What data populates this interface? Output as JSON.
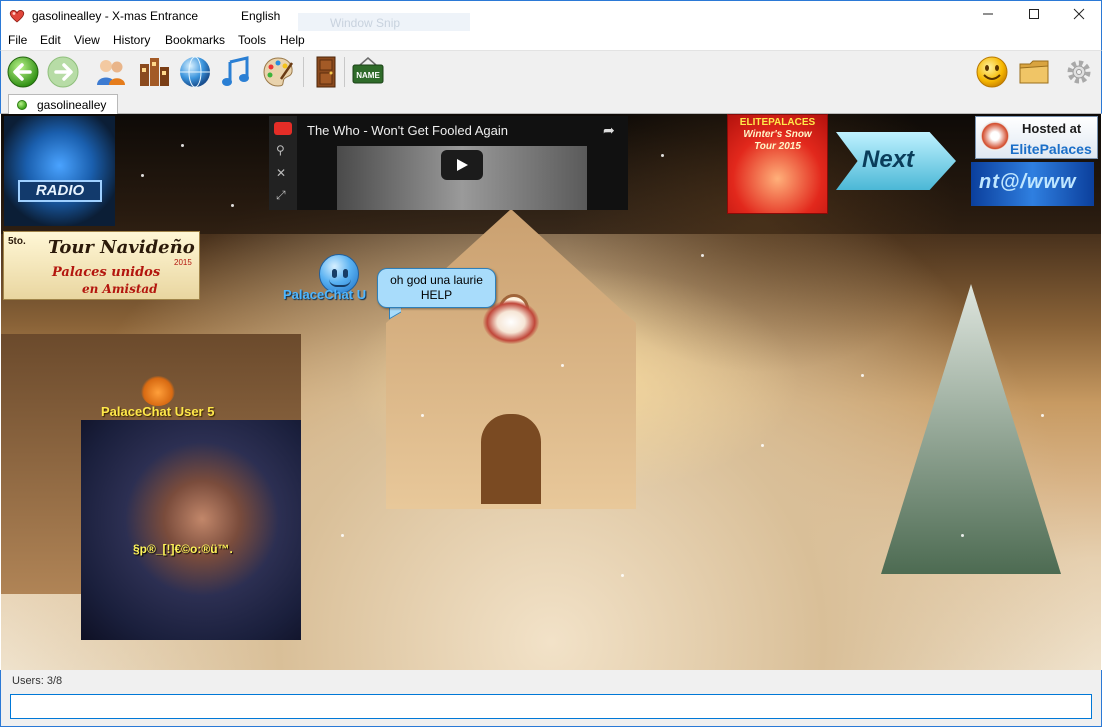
{
  "window": {
    "title": "gasolinealley - X-mas Entrance",
    "language": "English",
    "ghost_label": "Window Snip"
  },
  "menu": [
    "File",
    "Edit",
    "View",
    "History",
    "Bookmarks",
    "Tools",
    "Help"
  ],
  "toolbar": {
    "buttons": [
      "back-icon",
      "forward-icon",
      "users-icon",
      "rooms-icon",
      "globe-icon",
      "music-icon",
      "palette-icon",
      "door-icon",
      "name-tag-icon",
      "smiley-icon",
      "props-folder-icon",
      "settings-gear-icon"
    ],
    "name_tag_label": "NAME"
  },
  "tabs": [
    {
      "label": "gasolinealley"
    }
  ],
  "room": {
    "youtube": {
      "title": "The Who - Won't Get Fooled Again"
    },
    "props": {
      "radio": "RADIO",
      "snow_tour_brand": "ELITEPALACES",
      "snow_tour_line1": "Winter's Snow",
      "snow_tour_line2": "Tour 2015",
      "next": "Next",
      "hosted_line1": "Hosted at",
      "hosted_line2": "ElitePalaces",
      "www": "nt@/www",
      "tour_small": "5to.",
      "tour_title": "Tour Navideño",
      "tour_year": "2015",
      "tour_line2": "Palaces unidos",
      "tour_line3": "en Amistad"
    },
    "users": [
      {
        "name": "PalaceChat U",
        "bubble_line1": "oh god una laurie",
        "bubble_line2": "HELP"
      },
      {
        "name": "PalaceChat User 5",
        "signature": "§p®_[!]€©o:®ü™."
      }
    ]
  },
  "status": {
    "users": "Users: 3/8"
  },
  "chat_input": {
    "value": ""
  }
}
